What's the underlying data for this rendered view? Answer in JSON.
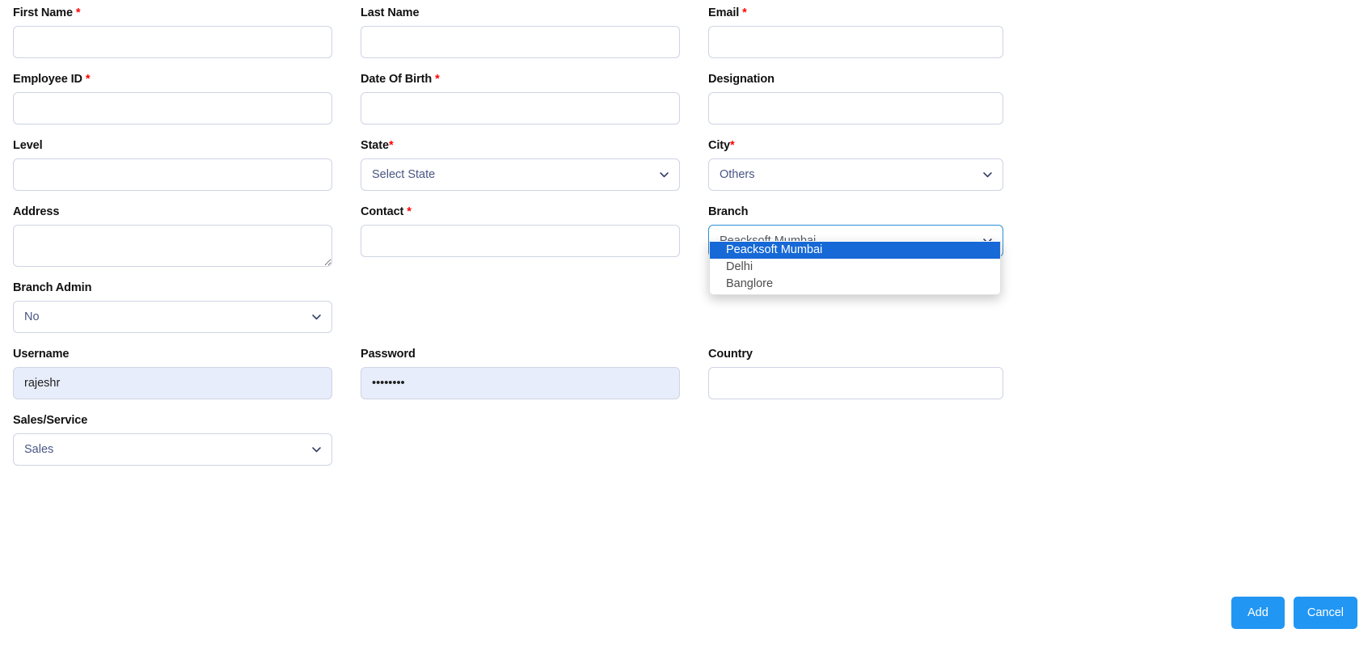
{
  "colors": {
    "required_asterisk": "#ff0000",
    "button_primary": "#2196f3",
    "dropdown_highlight": "#1669d6",
    "focused_border": "#2d8fd5",
    "autofill_background": "#e8edfb",
    "input_border": "#ced4e3"
  },
  "form": {
    "fields": {
      "first_name": {
        "label": "First Name",
        "required_mark": "*",
        "value": "",
        "placeholder": ""
      },
      "last_name": {
        "label": "Last Name",
        "required_mark": "",
        "value": "",
        "placeholder": ""
      },
      "email": {
        "label": "Email",
        "required_mark": "*",
        "value": "",
        "placeholder": ""
      },
      "employee_id": {
        "label": "Employee ID",
        "required_mark": "*",
        "value": "",
        "placeholder": ""
      },
      "date_of_birth": {
        "label": "Date Of Birth",
        "required_mark": "*",
        "value": "",
        "placeholder": ""
      },
      "designation": {
        "label": "Designation",
        "required_mark": "",
        "value": "",
        "placeholder": ""
      },
      "level": {
        "label": "Level",
        "required_mark": "",
        "value": "",
        "placeholder": ""
      },
      "state": {
        "label": "State",
        "required_mark": "*",
        "selected": "Select State",
        "options": [
          "Select State"
        ]
      },
      "city": {
        "label": "City",
        "required_mark": "*",
        "selected": "Others",
        "options": [
          "Others"
        ]
      },
      "address": {
        "label": "Address",
        "required_mark": "",
        "value": "",
        "placeholder": ""
      },
      "contact": {
        "label": "Contact",
        "required_mark": "*",
        "value": "",
        "placeholder": ""
      },
      "branch": {
        "label": "Branch",
        "required_mark": "",
        "selected": "Peacksoft Mumbai",
        "expanded": true,
        "options": [
          {
            "label": "Peacksoft Mumbai",
            "highlighted": true
          },
          {
            "label": "Delhi",
            "highlighted": false
          },
          {
            "label": "Banglore",
            "highlighted": false
          }
        ]
      },
      "branch_admin": {
        "label": "Branch Admin",
        "required_mark": "",
        "selected": "No",
        "options": [
          "No"
        ]
      },
      "username": {
        "label": "Username",
        "required_mark": "",
        "value": "rajeshr",
        "placeholder": ""
      },
      "password": {
        "label": "Password",
        "required_mark": "",
        "value": "••••••••",
        "placeholder": ""
      },
      "country": {
        "label": "Country",
        "required_mark": "",
        "value": "",
        "placeholder": ""
      },
      "sales_service": {
        "label": "Sales/Service",
        "required_mark": "",
        "selected": "Sales",
        "options": [
          "Sales"
        ]
      }
    },
    "actions": {
      "add_label": "Add",
      "cancel_label": "Cancel"
    }
  }
}
